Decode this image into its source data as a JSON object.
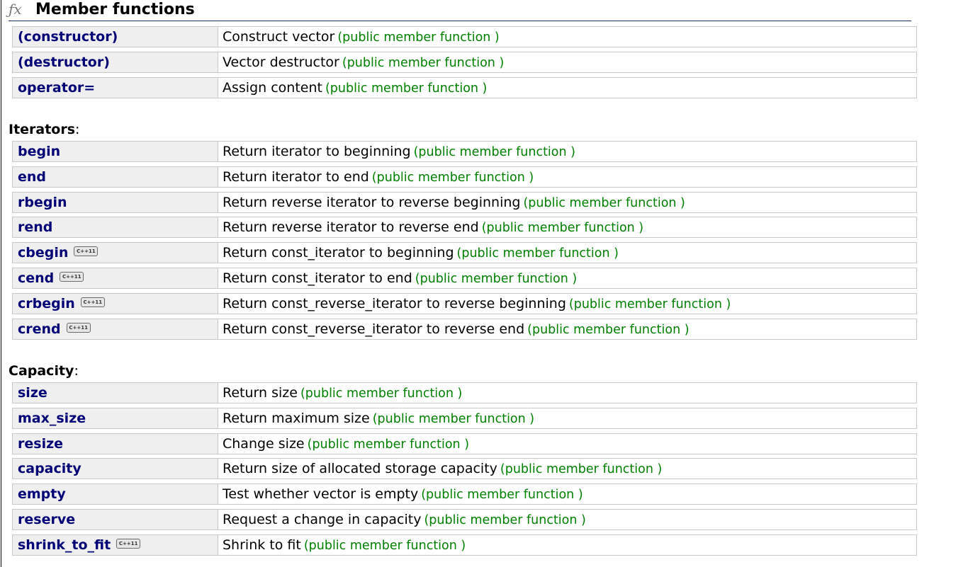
{
  "header": {
    "icon": "fx-icon",
    "title": "Member functions"
  },
  "colors": {
    "link": "#000077",
    "kind": "#008000",
    "name_cell_bg": "#efefef",
    "border": "#c8c8c8"
  },
  "groups": [
    {
      "heading": "",
      "rows": [
        {
          "name": "(constructor)",
          "badge": "",
          "description": "Construct vector",
          "kind": "(public member function )"
        },
        {
          "name": "(destructor)",
          "badge": "",
          "description": "Vector destructor",
          "kind": "(public member function )"
        },
        {
          "name": "operator=",
          "badge": "",
          "description": "Assign content",
          "kind": "(public member function )"
        }
      ]
    },
    {
      "heading": "Iterators",
      "rows": [
        {
          "name": "begin",
          "badge": "",
          "description": "Return iterator to beginning",
          "kind": "(public member function )"
        },
        {
          "name": "end",
          "badge": "",
          "description": "Return iterator to end",
          "kind": "(public member function )"
        },
        {
          "name": "rbegin",
          "badge": "",
          "description": "Return reverse iterator to reverse beginning",
          "kind": "(public member function )"
        },
        {
          "name": "rend",
          "badge": "",
          "description": "Return reverse iterator to reverse end",
          "kind": "(public member function )"
        },
        {
          "name": "cbegin",
          "badge": "C++11",
          "description": "Return const_iterator to beginning",
          "kind": "(public member function )"
        },
        {
          "name": "cend",
          "badge": "C++11",
          "description": "Return const_iterator to end",
          "kind": "(public member function )"
        },
        {
          "name": "crbegin",
          "badge": "C++11",
          "description": "Return const_reverse_iterator to reverse beginning",
          "kind": "(public member function )"
        },
        {
          "name": "crend",
          "badge": "C++11",
          "description": "Return const_reverse_iterator to reverse end",
          "kind": "(public member function )"
        }
      ]
    },
    {
      "heading": "Capacity",
      "rows": [
        {
          "name": "size",
          "badge": "",
          "description": "Return size",
          "kind": "(public member function )"
        },
        {
          "name": "max_size",
          "badge": "",
          "description": "Return maximum size",
          "kind": "(public member function )"
        },
        {
          "name": "resize",
          "badge": "",
          "description": "Change size",
          "kind": "(public member function )"
        },
        {
          "name": "capacity",
          "badge": "",
          "description": "Return size of allocated storage capacity",
          "kind": "(public member function )"
        },
        {
          "name": "empty",
          "badge": "",
          "description": "Test whether vector is empty",
          "kind": "(public member function )"
        },
        {
          "name": "reserve",
          "badge": "",
          "description": "Request a change in capacity",
          "kind": "(public member function )"
        },
        {
          "name": "shrink_to_fit",
          "badge": "C++11",
          "description": "Shrink to fit",
          "kind": "(public member function )"
        }
      ]
    }
  ]
}
